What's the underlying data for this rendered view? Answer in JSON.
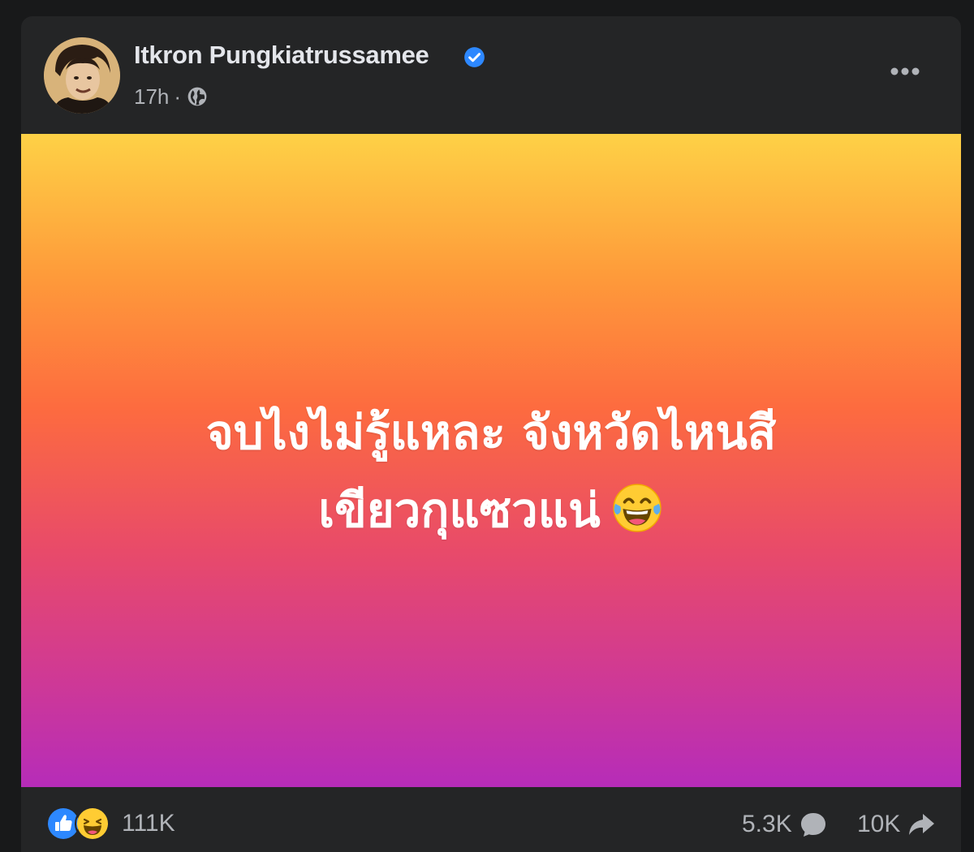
{
  "post": {
    "author": "Itkron Pungkiatrussamee",
    "verified_icon": "verified-badge-icon",
    "time": "17h",
    "separator": "·",
    "audience_icon": "globe-icon",
    "more_icon": "more-options-icon",
    "text_lines": [
      "จบไงไม่รู้แหละ จังหวัดไหนสี",
      "เขียวกุแซวแน่"
    ],
    "emoji": "laughing-tears-emoji",
    "background_colors": [
      "#fed146",
      "#fd6b3f",
      "#b62cb9"
    ]
  },
  "footer": {
    "reaction_icons": [
      "like-icon",
      "haha-icon"
    ],
    "reaction_count": "111K",
    "comment_count": "5.3K",
    "comment_icon": "comment-icon",
    "share_count": "10K",
    "share_icon": "share-icon"
  },
  "colors": {
    "page_bg": "#18191a",
    "card_bg": "#242526",
    "accent_blue": "#2d88ff",
    "text_primary": "#e4e6eb",
    "text_secondary": "#b0b3b8"
  }
}
